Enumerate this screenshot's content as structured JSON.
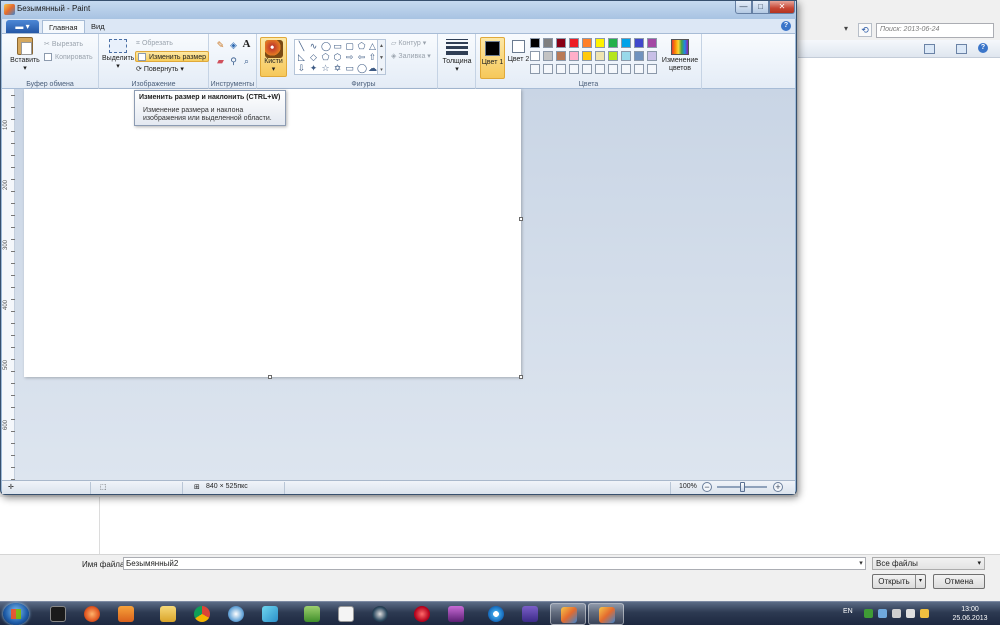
{
  "window": {
    "title": "Безымянный - Paint"
  },
  "ribbon": {
    "app_menu_glyph": "▬ ▾",
    "tabs": [
      "Главная",
      "Вид"
    ],
    "help_glyph": "?",
    "clipboard": {
      "group_label": "Буфер обмена",
      "paste": "Вставить",
      "cut": "Вырезать",
      "copy": "Копировать"
    },
    "image": {
      "group_label": "Изображение",
      "select": "Выделить",
      "crop": "Обрезать",
      "resize": "Изменить размер",
      "rotate": "Повернуть"
    },
    "tools": {
      "group_label": "Инструменты",
      "text_glyph": "A"
    },
    "brushes": {
      "label": "Кисти"
    },
    "shapes": {
      "group_label": "Фигуры",
      "outline": "Контур",
      "fill": "Заливка"
    },
    "thickness": {
      "label": "Толщина"
    },
    "colors": {
      "group_label": "Цвета",
      "color1_label": "Цвет 1",
      "color2_label": "Цвет 2",
      "edit_colors": "Изменение цветов",
      "color1_value": "#000000",
      "color2_value": "#ffffff",
      "palette": [
        "#000000",
        "#7f7f7f",
        "#880015",
        "#ed1c24",
        "#ff7f27",
        "#fff200",
        "#22b14c",
        "#00a2e8",
        "#3f48cc",
        "#a349a4",
        "#ffffff",
        "#c3c3c3",
        "#b97a57",
        "#ffaec9",
        "#ffc90e",
        "#efe4b0",
        "#b5e61d",
        "#99d9ea",
        "#7092be",
        "#c8bfe7"
      ]
    }
  },
  "tooltip": {
    "title": "Изменить размер и наклонить (CTRL+W)",
    "description": "Изменение размера и наклона изображения или выделенной области."
  },
  "ruler": {
    "marks": [
      "100",
      "200",
      "300",
      "400",
      "500",
      "600"
    ]
  },
  "statusbar": {
    "canvas_size": "840 × 525пкс",
    "zoom": "100%",
    "zoom_level": 1.0
  },
  "dialog": {
    "search_placeholder": "Поиск: 2013-06-24",
    "filename_label": "Имя файла:",
    "filename_value": "Безымянный2",
    "filetype": "Все файлы",
    "open_button": "Открыть",
    "cancel_button": "Отмена"
  },
  "taskbar": {
    "language": "EN",
    "time": "13:00",
    "date": "25.06.2013"
  }
}
